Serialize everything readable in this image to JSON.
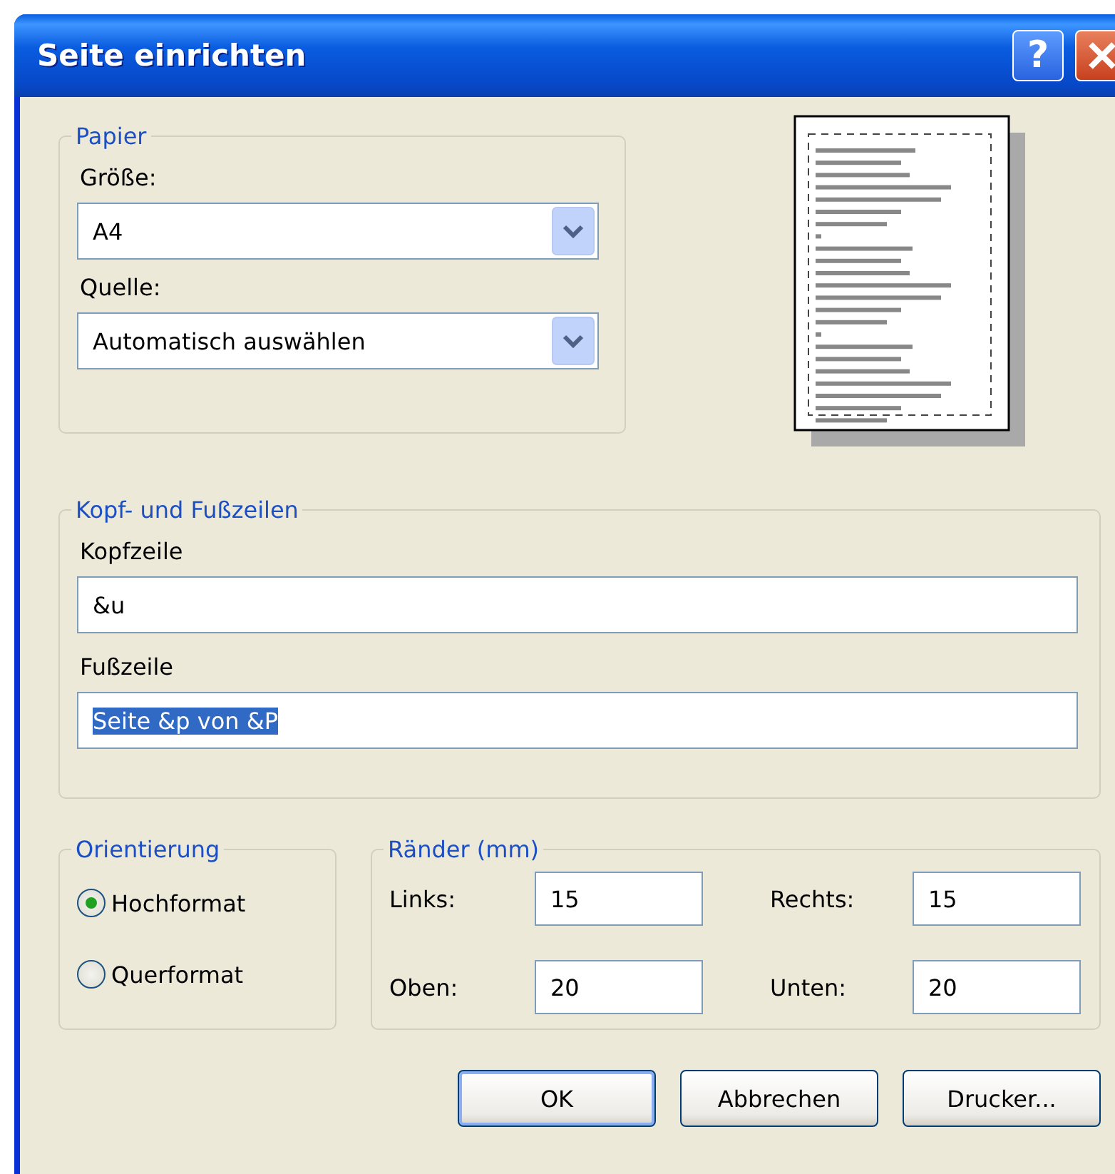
{
  "window": {
    "title": "Seite einrichten",
    "help_button": "?"
  },
  "paper": {
    "title": "Papier",
    "fields": [
      {
        "label": "Größe:",
        "value": "A4"
      },
      {
        "label": "Quelle:",
        "value": "Automatisch auswählen"
      }
    ]
  },
  "headers": {
    "title": "Kopf- und Fußzeilen",
    "fields": [
      {
        "label": "Kopfzeile",
        "value": "&u",
        "selected": false
      },
      {
        "label": "Fußzeile",
        "value": "Seite &p von &P",
        "selected": true
      }
    ]
  },
  "orientation": {
    "title": "Orientierung",
    "options": [
      {
        "label": "Hochformat",
        "selected": true
      },
      {
        "label": "Querformat",
        "selected": false
      }
    ]
  },
  "margins": {
    "title": "Ränder (mm)",
    "fields": [
      {
        "label": "Links:",
        "value": "15"
      },
      {
        "label": "Rechts:",
        "value": "15"
      },
      {
        "label": "Oben:",
        "value": "20"
      },
      {
        "label": "Unten:",
        "value": "20"
      }
    ]
  },
  "buttons": [
    {
      "label": "OK",
      "default": true
    },
    {
      "label": "Abbrechen",
      "default": false
    },
    {
      "label": "Drucker...",
      "default": false
    }
  ]
}
